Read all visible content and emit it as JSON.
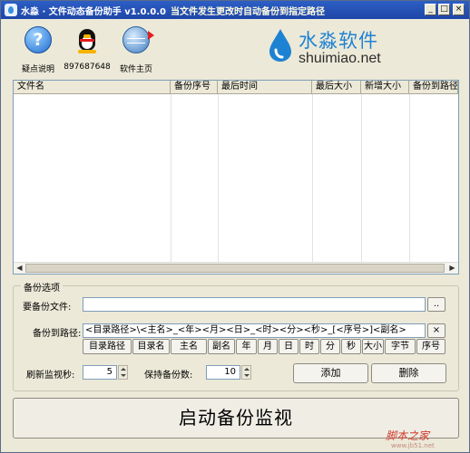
{
  "window": {
    "title": "水淼 · 文件动态备份助手 v1.0.0.0",
    "subtitle": "当文件发生更改时自动备份到指定路径",
    "controls": [
      "_",
      "□",
      "×"
    ]
  },
  "toolbar": {
    "items": [
      {
        "label": "疑点说明",
        "icon": "help-icon"
      },
      {
        "label": "897687648",
        "icon": "qq-penguin-icon"
      },
      {
        "label": "软件主页",
        "icon": "globe-icon"
      }
    ]
  },
  "logo": {
    "text_cn": "水淼软件",
    "text_url": "shuimiao.net",
    "colors": {
      "blue": "#1e82d2"
    }
  },
  "list": {
    "columns": [
      "文件名",
      "备份序号",
      "最后时间",
      "最后大小",
      "新增大小",
      "备份到路径"
    ],
    "rows": []
  },
  "options": {
    "group_label": "备份选项",
    "file_label": "要备份文件:",
    "file_value": "",
    "browse_label": "..",
    "path_label": "备份到路径:",
    "path_value": "<目录路径>\\<主名>_<年><月><日>_<时><分><秒>_[<序号>]<副名>",
    "clear_label": "×",
    "tokens": [
      "目录路径",
      "目录名",
      "主名",
      "副名",
      "年",
      "月",
      "日",
      "时",
      "分",
      "秒",
      "大小",
      "字节",
      "序号"
    ],
    "refresh_label": "刷新监视秒:",
    "refresh_value": "5",
    "keep_label": "保持备份数:",
    "keep_value": "10",
    "add_label": "添加",
    "delete_label": "删除"
  },
  "start_label": "启动备份监视",
  "watermark": {
    "text": "脚本之家",
    "url": "www.jb51.net"
  }
}
